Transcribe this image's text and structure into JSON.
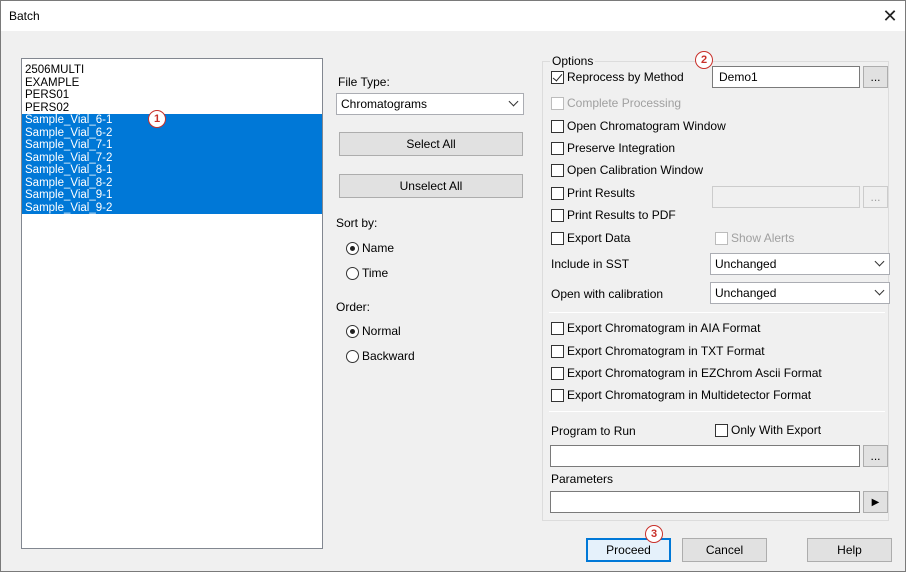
{
  "window": {
    "title": "Batch",
    "close": "✕"
  },
  "files": [
    {
      "name": "2506MULTI",
      "selected": false
    },
    {
      "name": "EXAMPLE",
      "selected": false
    },
    {
      "name": "PERS01",
      "selected": false
    },
    {
      "name": "PERS02",
      "selected": false
    },
    {
      "name": "Sample_Vial_6-1",
      "selected": true
    },
    {
      "name": "Sample_Vial_6-2",
      "selected": true
    },
    {
      "name": "Sample_Vial_7-1",
      "selected": true
    },
    {
      "name": "Sample_Vial_7-2",
      "selected": true
    },
    {
      "name": "Sample_Vial_8-1",
      "selected": true
    },
    {
      "name": "Sample_Vial_8-2",
      "selected": true
    },
    {
      "name": "Sample_Vial_9-1",
      "selected": true
    },
    {
      "name": "Sample_Vial_9-2",
      "selected": true
    }
  ],
  "middle": {
    "file_type_label": "File Type:",
    "file_type_value": "Chromatograms",
    "select_all": "Select All",
    "unselect_all": "Unselect All",
    "sort_label": "Sort by:",
    "sort_name": "Name",
    "sort_time": "Time",
    "order_label": "Order:",
    "order_normal": "Normal",
    "order_backward": "Backward"
  },
  "options": {
    "group_label": "Options",
    "reprocess": "Reprocess by Method",
    "method_value": "Demo1",
    "browse": "...",
    "complete_processing": "Complete Processing",
    "open_chrom_window": "Open Chromatogram Window",
    "preserve_integration": "Preserve Integration",
    "open_calibration_window": "Open Calibration Window",
    "print_results": "Print Results",
    "print_pdf": "Print Results to PDF",
    "export_data": "Export Data",
    "show_alerts": "Show Alerts",
    "include_sst_label": "Include in SST",
    "include_sst_value": "Unchanged",
    "open_with_cal_label": "Open with calibration",
    "open_with_cal_value": "Unchanged",
    "export_aia": "Export Chromatogram in AIA Format",
    "export_txt": "Export Chromatogram in TXT Format",
    "export_ezchrom": "Export Chromatogram in EZChrom Ascii Format",
    "export_multi": "Export Chromatogram in Multidetector Format",
    "program_label": "Program to Run",
    "only_with_export": "Only With Export",
    "parameters_label": "Parameters",
    "run_arrow": "▶"
  },
  "buttons": {
    "proceed": "Proceed",
    "cancel": "Cancel",
    "help": "Help"
  },
  "markers": {
    "m1": "1",
    "m2": "2",
    "m3": "3"
  },
  "colors": {
    "selection": "#0078d7",
    "marker": "#c8302a"
  }
}
